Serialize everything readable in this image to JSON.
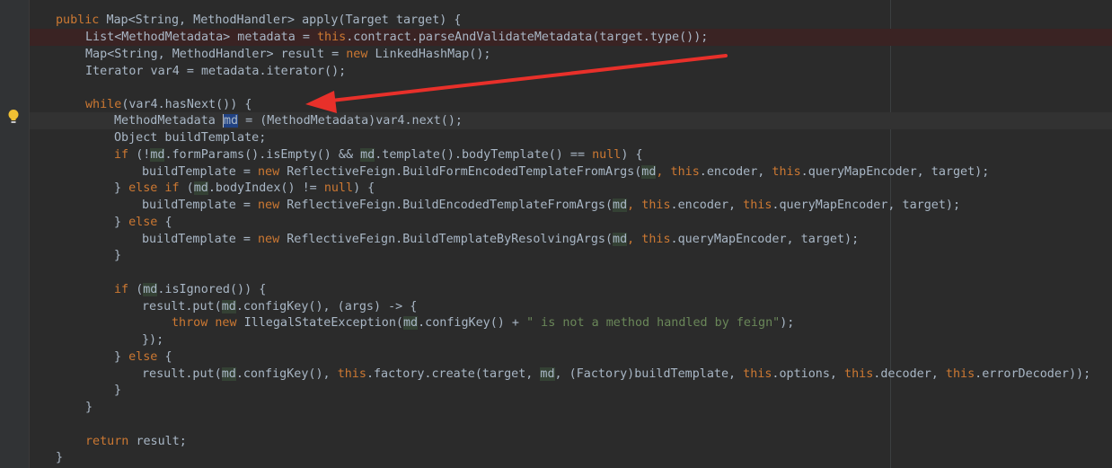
{
  "colors": {
    "background": "#2b2b2b",
    "keyword": "#cc7832",
    "string": "#6a8759",
    "arrow": "#e8302a"
  },
  "icons": {
    "intention": "lightbulb-icon"
  },
  "code": {
    "l1a": "public ",
    "l1b": "Map<String, MethodHandler> apply(Target target) {",
    "l2a": "List<MethodMetadata> metadata = ",
    "l2b": "this",
    "l2c": ".contract.parseAndValidateMetadata(target.type());",
    "l3a": "Map<String, MethodHandler> result = ",
    "l3b": "new ",
    "l3c": "LinkedHashMap();",
    "l4": "Iterator var4 = metadata.iterator();",
    "l6a": "while",
    "l6b": "(var4.hasNext()) {",
    "l7a": "MethodMetadata ",
    "l7b": "md",
    "l7c": " = (MethodMetadata)var4.next();",
    "l8": "Object buildTemplate;",
    "l9a": "if ",
    "l9b": "(!",
    "l9c": "md",
    "l9d": ".formParams().isEmpty() && ",
    "l9e": "md",
    "l9f": ".template().bodyTemplate() == ",
    "l9g": "null",
    "l9h": ") {",
    "l10a": "buildTemplate = ",
    "l10b": "new ",
    "l10c": "ReflectiveFeign.BuildFormEncodedTemplateFromArgs(",
    "l10d": "md",
    "l10e": ", ",
    "l10f": "this",
    "l10g": ".encoder, ",
    "l10h": "this",
    "l10i": ".queryMapEncoder, target);",
    "l11a": "} ",
    "l11b": "else if ",
    "l11c": "(",
    "l11d": "md",
    "l11e": ".bodyIndex() != ",
    "l11f": "null",
    "l11g": ") {",
    "l12a": "buildTemplate = ",
    "l12b": "new ",
    "l12c": "ReflectiveFeign.BuildEncodedTemplateFromArgs(",
    "l12d": "md",
    "l12e": ", ",
    "l12f": "this",
    "l12g": ".encoder, ",
    "l12h": "this",
    "l12i": ".queryMapEncoder, target);",
    "l13a": "} ",
    "l13b": "else ",
    "l13c": "{",
    "l14a": "buildTemplate = ",
    "l14b": "new ",
    "l14c": "ReflectiveFeign.BuildTemplateByResolvingArgs(",
    "l14d": "md",
    "l14e": ", ",
    "l14f": "this",
    "l14g": ".queryMapEncoder, target);",
    "l15": "}",
    "l17a": "if ",
    "l17b": "(",
    "l17c": "md",
    "l17d": ".isIgnored()) {",
    "l18a": "result.put(",
    "l18b": "md",
    "l18c": ".configKey(), (args) -> {",
    "l19a": "throw new ",
    "l19b": "IllegalStateException(",
    "l19c": "md",
    "l19d": ".configKey() + ",
    "l19e": "\" is not a method handled by feign\"",
    "l19f": ");",
    "l20": "});",
    "l21a": "} ",
    "l21b": "else ",
    "l21c": "{",
    "l22a": "result.put(",
    "l22b": "md",
    "l22c": ".configKey(), ",
    "l22d": "this",
    "l22e": ".factory.create(target, ",
    "l22f": "md",
    "l22g": ", (Factory)buildTemplate, ",
    "l22h": "this",
    "l22i": ".options, ",
    "l22j": "this",
    "l22k": ".decoder, ",
    "l22l": "this",
    "l22m": ".errorDecoder));",
    "l23": "}",
    "l24": "}",
    "l26a": "return ",
    "l26b": "result;",
    "l27": "}"
  }
}
